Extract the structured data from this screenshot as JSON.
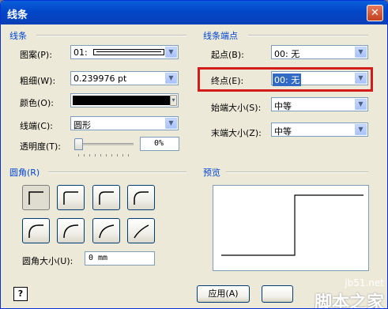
{
  "window": {
    "title": "线条",
    "close": "✕"
  },
  "line_section": {
    "title": "线条",
    "pattern": {
      "label": "图案(P):",
      "value": "01:"
    },
    "weight": {
      "label": "粗细(W):",
      "value": "0.239976 pt"
    },
    "color": {
      "label": "颜色(O):",
      "value": "#000000"
    },
    "cap": {
      "label": "线端(C):",
      "value": "圆形"
    },
    "transparency": {
      "label": "透明度(T):",
      "value": "0%",
      "level": 0
    }
  },
  "endpoints_section": {
    "title": "线条端点",
    "begin": {
      "label": "起点(B):",
      "value": "00: 无"
    },
    "end": {
      "label": "终点(E):",
      "value": "00: 无"
    },
    "begin_size": {
      "label": "始端大小(S):",
      "value": "中等"
    },
    "end_size": {
      "label": "末端大小(Z):",
      "value": "中等"
    }
  },
  "rounding_section": {
    "title": "圆角(R)",
    "size_label": "圆角大小(U):",
    "size_value": "0 mm"
  },
  "preview_section": {
    "title": "预览"
  },
  "buttons": {
    "help": "?",
    "apply": "应用(A)"
  },
  "watermark": {
    "site": "jb51.net",
    "brand": "脚本之家"
  },
  "colors": {
    "highlight": "#d21c1c",
    "accent": "#0046d5"
  }
}
